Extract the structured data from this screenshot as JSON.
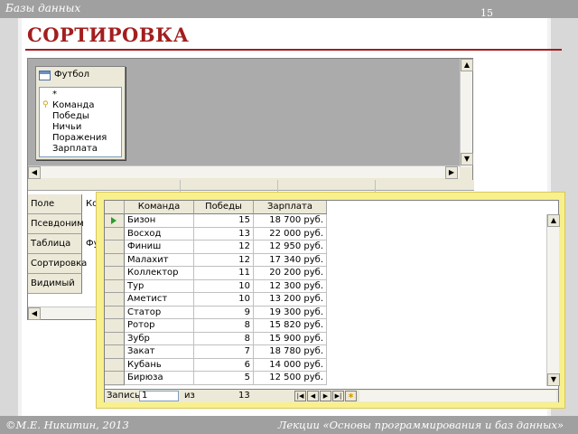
{
  "slide": {
    "header": "Базы данных",
    "number": "15",
    "title": "СОРТИРОВКА",
    "footer_left": "©М.Е. Никитин, 2013",
    "footer_right": "Лекции «Основы программирования и баз данных»"
  },
  "designer": {
    "table_name": "Футбол",
    "fields": [
      "*",
      "Команда",
      "Победы",
      "Ничьи",
      "Поражения",
      "Зарплата"
    ],
    "row_labels": [
      "Поле",
      "Псевдоним",
      "Таблица",
      "Сортировка",
      "Видимый"
    ],
    "field_cell": "Ко",
    "table_cell": "Фу"
  },
  "datasheet": {
    "columns": [
      "Команда",
      "Победы",
      "Зарплата"
    ],
    "rows": [
      [
        "Бизон",
        "15",
        "18 700 руб."
      ],
      [
        "Восход",
        "13",
        "22 000 руб."
      ],
      [
        "Финиш",
        "12",
        "12 950 руб."
      ],
      [
        "Малахит",
        "12",
        "17 340 руб."
      ],
      [
        "Коллектор",
        "11",
        "20 200 руб."
      ],
      [
        "Тур",
        "10",
        "12 300 руб."
      ],
      [
        "Аметист",
        "10",
        "13 200 руб."
      ],
      [
        "Статор",
        "9",
        "19 300 руб."
      ],
      [
        "Ротор",
        "8",
        "15 820 руб."
      ],
      [
        "Зубр",
        "8",
        "15 900 руб."
      ],
      [
        "Закат",
        "7",
        "18 780 руб."
      ],
      [
        "Кубань",
        "6",
        "14 000 руб."
      ],
      [
        "Бирюза",
        "5",
        "12 500 руб."
      ]
    ],
    "current_row": 0
  },
  "navigator": {
    "record_label": "Запись",
    "record_value": "1",
    "of_label": "из",
    "total": "13"
  }
}
